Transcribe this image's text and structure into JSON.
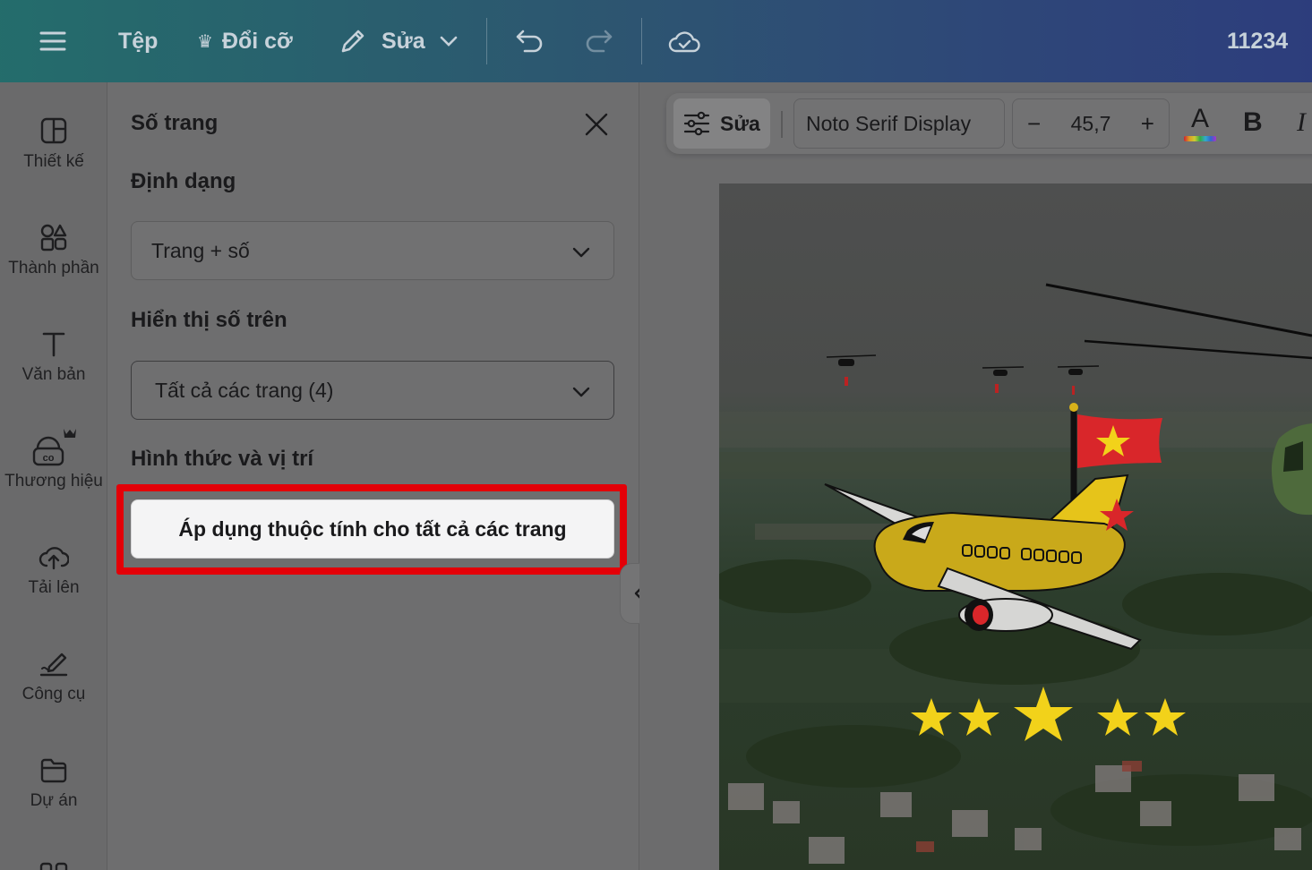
{
  "topbar": {
    "file_label": "Tệp",
    "resize_label": "Đổi cỡ",
    "edit_label": "Sửa",
    "project_title": "11234"
  },
  "rail": {
    "items": [
      {
        "label": "Thiết kế",
        "icon": "design-layout-icon"
      },
      {
        "label": "Thành phần",
        "icon": "elements-icon"
      },
      {
        "label": "Văn bản",
        "icon": "text-icon"
      },
      {
        "label": "Thương hiệu",
        "icon": "brand-kit-icon"
      },
      {
        "label": "Tải lên",
        "icon": "upload-cloud-icon"
      },
      {
        "label": "Công cụ",
        "icon": "draw-tools-icon"
      },
      {
        "label": "Dự án",
        "icon": "folder-icon"
      }
    ]
  },
  "panel": {
    "title": "Số trang",
    "format_label": "Định dạng",
    "format_value": "Trang + số",
    "show_on_label": "Hiển thị số trên",
    "show_on_value": "Tất cả các trang (4)",
    "style_label": "Hình thức và vị trí",
    "apply_button": "Áp dụng thuộc tính cho tất cả các trang"
  },
  "context_toolbar": {
    "edit_label": "Sửa",
    "font_name": "Noto Serif Display",
    "font_size": "45,7",
    "decrease": "−",
    "increase": "+",
    "color_letter": "A",
    "bold": "B",
    "italic": "I"
  },
  "colors": {
    "highlight": "#e30008",
    "plane_body": "#e6c41a",
    "flag_red": "#d9262a",
    "star_yellow": "#f2d21a"
  }
}
